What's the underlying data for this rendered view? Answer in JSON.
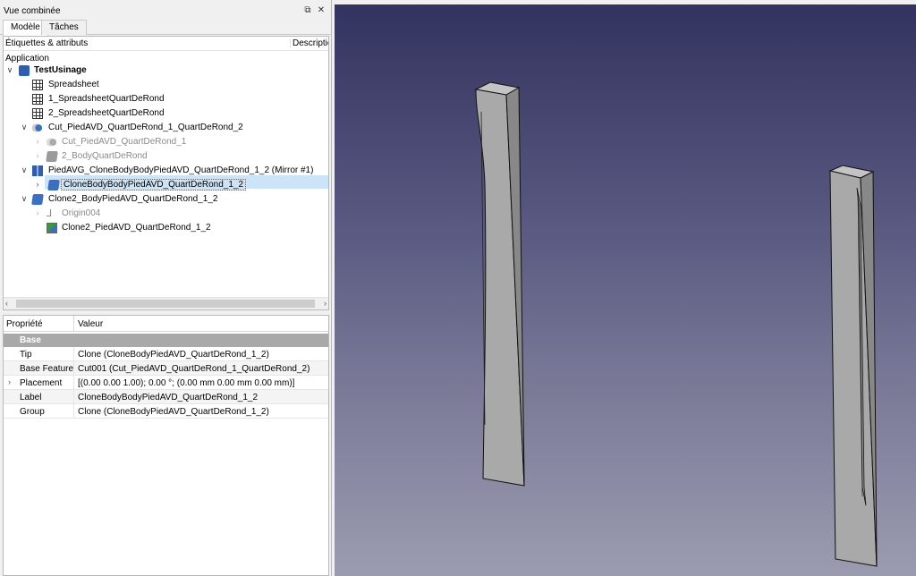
{
  "combo": {
    "title": "Vue combinée",
    "float_icon": "float-icon",
    "close_icon": "close-icon",
    "tabs": [
      {
        "label": "Modèle",
        "active": true
      },
      {
        "label": "Tâches",
        "active": false
      }
    ]
  },
  "tree": {
    "header_labels": "Étiquettes & attributs",
    "header_description": "Description",
    "app_label": "Application",
    "items": [
      {
        "label": "TestUsinage",
        "icon": "document-icon"
      },
      {
        "label": "Spreadsheet",
        "icon": "spreadsheet-icon"
      },
      {
        "label": "1_SpreadsheetQuartDeRond",
        "icon": "spreadsheet-icon"
      },
      {
        "label": "2_SpreadsheetQuartDeRond",
        "icon": "spreadsheet-icon"
      },
      {
        "label": "Cut_PiedAVD_QuartDeRond_1_QuartDeRond_2",
        "icon": "cut-icon"
      },
      {
        "label": "Cut_PiedAVD_QuartDeRond_1",
        "icon": "cut-icon"
      },
      {
        "label": "2_BodyQuartDeRond",
        "icon": "body-icon"
      },
      {
        "label": "PiedAVG_CloneBodyBodyPiedAVD_QuartDeRond_1_2 (Mirror #1)",
        "icon": "mirror-icon"
      },
      {
        "label": "CloneBodyBodyPiedAVD_QuartDeRond_1_2",
        "icon": "body-icon"
      },
      {
        "label": "Clone2_BodyPiedAVD_QuartDeRond_1_2",
        "icon": "body-icon"
      },
      {
        "label": "Origin004",
        "icon": "origin-icon"
      },
      {
        "label": "Clone2_PiedAVD_QuartDeRond_1_2",
        "icon": "clone-icon"
      }
    ]
  },
  "props": {
    "col_property": "Propriété",
    "col_value": "Valeur",
    "group": "Base",
    "rows": [
      {
        "name": "Tip",
        "value": "Clone (CloneBodyPiedAVD_QuartDeRond_1_2)"
      },
      {
        "name": "Base Feature",
        "value": "Cut001 (Cut_PiedAVD_QuartDeRond_1_QuartDeRond_2)"
      },
      {
        "name": "Placement",
        "value": "[(0.00 0.00 1.00); 0.00 °; (0.00 mm  0.00 mm  0.00 mm)]"
      },
      {
        "name": "Label",
        "value": "CloneBodyBodyPiedAVD_QuartDeRond_1_2"
      },
      {
        "name": "Group",
        "value": "Clone (CloneBodyPiedAVD_QuartDeRond_1_2)"
      }
    ]
  }
}
